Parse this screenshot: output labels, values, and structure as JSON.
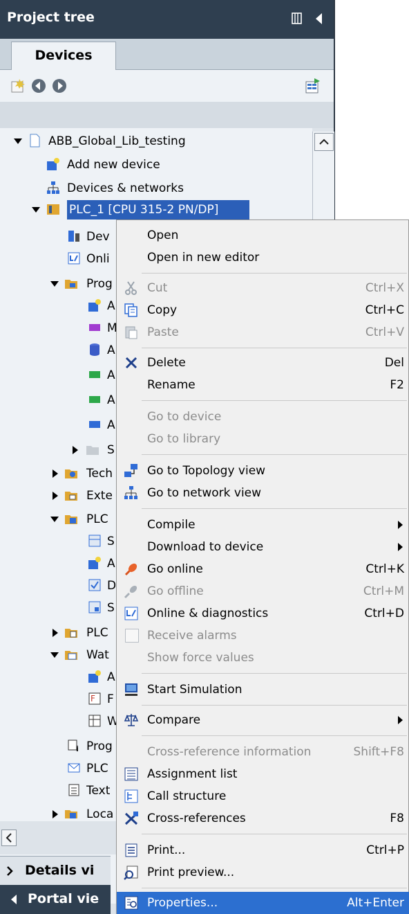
{
  "panel": {
    "title": "Project tree",
    "tab_label": "Devices",
    "details_view": "Details vi",
    "portal_view": "Portal vie"
  },
  "tree": [
    {
      "label": "ABB_Global_Lib_testing"
    },
    {
      "label": "Add new device"
    },
    {
      "label": "Devices & networks"
    },
    {
      "label": "PLC_1 [CPU 315-2 PN/DP]"
    },
    {
      "label": "Dev"
    },
    {
      "label": "Onli"
    },
    {
      "label": "Prog"
    },
    {
      "label": "A"
    },
    {
      "label": "M"
    },
    {
      "label": "A"
    },
    {
      "label": "A"
    },
    {
      "label": "A"
    },
    {
      "label": "A"
    },
    {
      "label": "S"
    },
    {
      "label": "Tech"
    },
    {
      "label": "Exte"
    },
    {
      "label": "PLC"
    },
    {
      "label": "S"
    },
    {
      "label": "A"
    },
    {
      "label": "D"
    },
    {
      "label": "S"
    },
    {
      "label": "PLC"
    },
    {
      "label": "Wat"
    },
    {
      "label": "A"
    },
    {
      "label": "F"
    },
    {
      "label": "W"
    },
    {
      "label": "Prog"
    },
    {
      "label": "PLC"
    },
    {
      "label": "Text"
    },
    {
      "label": "Loca"
    }
  ],
  "menu": [
    {
      "label": "Open",
      "shortcut": ""
    },
    {
      "label": "Open in new editor",
      "shortcut": ""
    },
    {
      "label": "Cut",
      "shortcut": "Ctrl+X"
    },
    {
      "label": "Copy",
      "shortcut": "Ctrl+C"
    },
    {
      "label": "Paste",
      "shortcut": "Ctrl+V"
    },
    {
      "label": "Delete",
      "shortcut": "Del"
    },
    {
      "label": "Rename",
      "shortcut": "F2"
    },
    {
      "label": "Go to device",
      "shortcut": ""
    },
    {
      "label": "Go to library",
      "shortcut": ""
    },
    {
      "label": "Go to Topology view",
      "shortcut": ""
    },
    {
      "label": "Go to network view",
      "shortcut": ""
    },
    {
      "label": "Compile",
      "shortcut": ""
    },
    {
      "label": "Download to device",
      "shortcut": ""
    },
    {
      "label": "Go online",
      "shortcut": "Ctrl+K"
    },
    {
      "label": "Go offline",
      "shortcut": "Ctrl+M"
    },
    {
      "label": "Online & diagnostics",
      "shortcut": "Ctrl+D"
    },
    {
      "label": "Receive alarms",
      "shortcut": ""
    },
    {
      "label": "Show force values",
      "shortcut": ""
    },
    {
      "label": "Start Simulation",
      "shortcut": ""
    },
    {
      "label": "Compare",
      "shortcut": ""
    },
    {
      "label": "Cross-reference information",
      "shortcut": "Shift+F8"
    },
    {
      "label": "Assignment list",
      "shortcut": ""
    },
    {
      "label": "Call structure",
      "shortcut": ""
    },
    {
      "label": "Cross-references",
      "shortcut": "F8"
    },
    {
      "label": "Print...",
      "shortcut": "Ctrl+P"
    },
    {
      "label": "Print preview...",
      "shortcut": ""
    },
    {
      "label": "Properties...",
      "shortcut": "Alt+Enter"
    }
  ]
}
